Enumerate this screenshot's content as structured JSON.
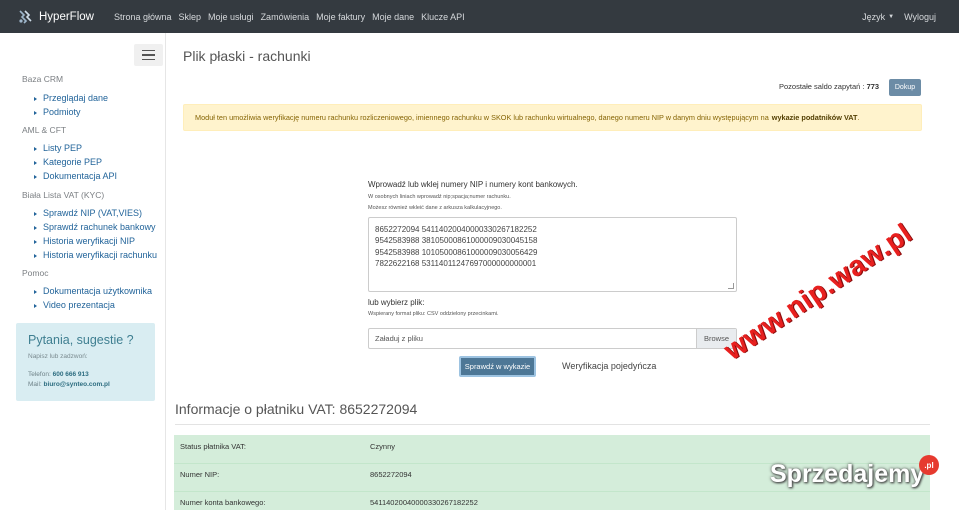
{
  "navbar": {
    "brand": "HyperFlow",
    "links": [
      "Strona główna",
      "Sklep",
      "Moje usługi",
      "Zamówienia",
      "Moje faktury",
      "Moje dane",
      "Klucze API"
    ],
    "language": "Język",
    "logout": "Wyloguj"
  },
  "sidebar": {
    "sections": [
      {
        "title": "Baza CRM",
        "items": [
          "Przeglądaj dane",
          "Podmioty"
        ]
      },
      {
        "title": "AML & CFT",
        "items": [
          "Listy PEP",
          "Kategorie PEP",
          "Dokumentacja API"
        ]
      },
      {
        "title": "Biała Lista VAT (KYC)",
        "items": [
          "Sprawdź NIP (VAT,VIES)",
          "Sprawdź rachunek bankowy",
          "Historia weryfikacji NIP",
          "Historia weryfikacji rachunku"
        ]
      },
      {
        "title": "Pomoc",
        "items": [
          "Dokumentacja użytkownika",
          "Video prezentacja"
        ]
      }
    ],
    "contact": {
      "title": "Pytania, sugestie ?",
      "subtitle": "Napisz lub zadzwoń:",
      "phone_label": "Telefon:",
      "phone": "600 666 913",
      "mail_label": "Mail:",
      "mail": "biuro@synteo.com.pl"
    }
  },
  "main": {
    "title": "Plik płaski - rachunki",
    "balance_label": "Pozostałe saldo zapytań :",
    "balance_value": "773",
    "dokup_button": "Dokup",
    "alert_text": "Moduł ten umożliwia weryfikację numeru rachunku rozliczeniowego, imiennego rachunku w SKOK lub rachunku wirtualnego, danego numeru NIP w danym dniu występującym na",
    "alert_bold": "wykazie podatników VAT",
    "form": {
      "label": "Wprowadź lub wklej numery NIP i numery kont bankowych.",
      "hint1": "W osobnych liniach wprowadź nip;spacja;numer rachunku.",
      "hint2": "Możesz również wkleić dane z arkusza kalkulacyjnego.",
      "lines": [
        "8652272094 54114020040000330267182252",
        "9542583988 38105000861000009030045158",
        "9542583988 10105000861000009030056429",
        "7822622168 53114011247697000000000001"
      ],
      "file_label": "lub wybierz plik:",
      "file_hint": "Wspierany format pliku: CSV oddzielony przecinkami.",
      "file_placeholder": "Załaduj z pliku",
      "browse": "Browse",
      "submit": "Sprawdź w wykazie",
      "single_link": "Weryfikacja pojedyńcza"
    },
    "result": {
      "title": "Informacje o płatniku VAT: 8652272094",
      "rows": [
        {
          "key": "Status płatnika VAT:",
          "value": "Czynny"
        },
        {
          "key": "Numer NIP:",
          "value": "8652272094"
        },
        {
          "key": "Numer konta bankowego:",
          "value": "54114020040000330267182252"
        }
      ]
    }
  },
  "watermarks": {
    "site": "www.nip.waw.pl",
    "marketplace": "Sprzedajemy",
    "marketplace_badge": ".pl"
  },
  "colors": {
    "navbar": "#343a40",
    "link": "#22649a",
    "alert_bg": "#fff3cd",
    "success_bg": "#d4edda",
    "primary_button": "#4d7796",
    "watermark_red": "#e8201f"
  }
}
